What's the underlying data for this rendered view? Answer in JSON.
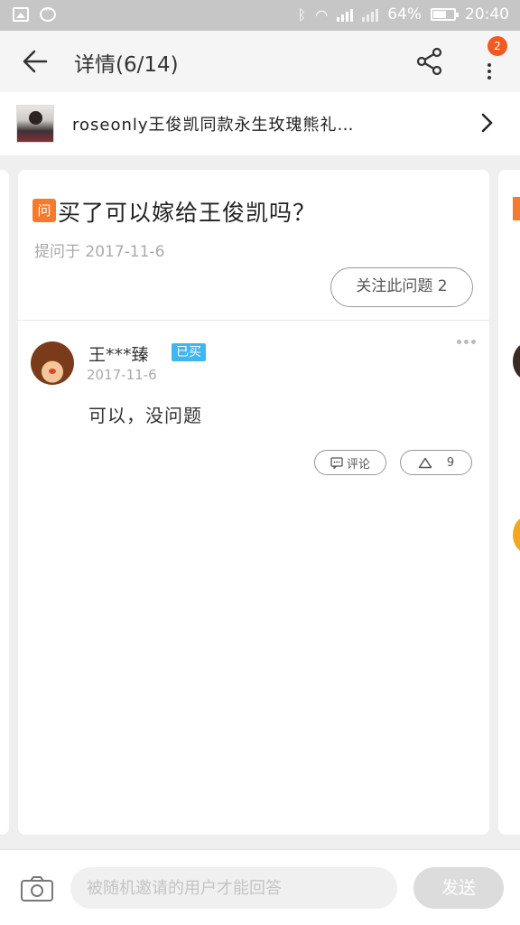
{
  "status_bar": {
    "battery": "64%",
    "time": "20:40",
    "icons": [
      "image-icon",
      "more-circle-icon",
      "bluetooth-icon",
      "wifi-icon",
      "signal-icon",
      "signal-icon",
      "battery-icon"
    ]
  },
  "header": {
    "title": "详情(6/14)",
    "notification_count": "2",
    "icons": [
      "back-arrow-icon",
      "share-icon",
      "more-vertical-icon"
    ]
  },
  "product": {
    "name": "roseonly王俊凯同款永生玫瑰熊礼…"
  },
  "question": {
    "tag": "问",
    "text": "买了可以嫁给王俊凯吗？",
    "asked_meta": "提问于 2017-11-6",
    "follow_label": "关注此问题 2"
  },
  "answer": {
    "user": "王***臻",
    "badge": "已买",
    "date": "2017-11-6",
    "text": "可以，没问题",
    "comment_label": "评论",
    "like_count": "9"
  },
  "reply_bar": {
    "placeholder": "被随机邀请的用户才能回答",
    "send_label": "发送"
  },
  "colors": {
    "accent": "#f47a2c",
    "badge_red": "#f05a22",
    "bought_blue": "#3fb6f0"
  }
}
